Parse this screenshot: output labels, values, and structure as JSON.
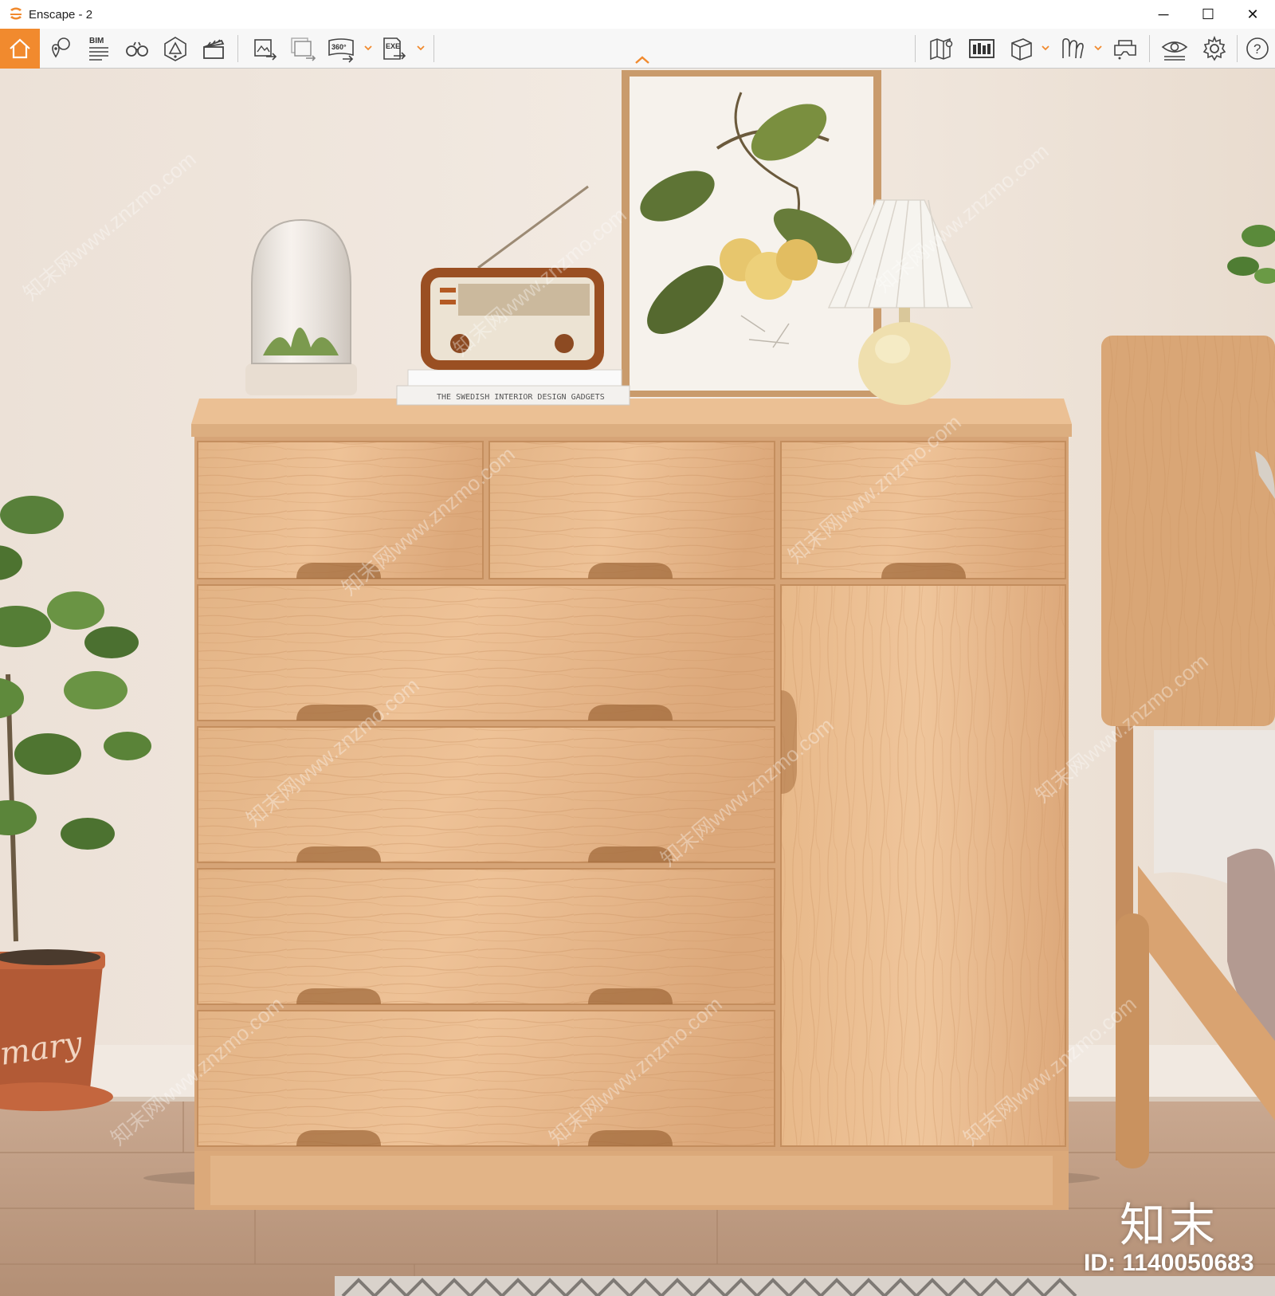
{
  "window": {
    "title": "Enscape - 2",
    "minimize_glyph": "─",
    "maximize_glyph": "☐",
    "close_glyph": "✕"
  },
  "toolbar": {
    "accent_color": "#f18a2e",
    "buttons": [
      {
        "name": "home-icon",
        "label": ""
      },
      {
        "name": "location-pin-icon",
        "label": ""
      },
      {
        "name": "bim-icon",
        "label": "BIM"
      },
      {
        "name": "binoculars-icon",
        "label": ""
      },
      {
        "name": "atmosphere-icon",
        "label": ""
      },
      {
        "name": "clapperboard-icon",
        "label": ""
      },
      {
        "name": "export-image-icon",
        "label": ""
      },
      {
        "name": "batch-render-icon",
        "label": ""
      },
      {
        "name": "panorama-export-icon",
        "label": "360°"
      },
      {
        "name": "exe-export-icon",
        "label": "EXE"
      },
      {
        "name": "map-icon",
        "label": ""
      },
      {
        "name": "asset-library-icon",
        "label": ""
      },
      {
        "name": "view-cube-icon",
        "label": ""
      },
      {
        "name": "materials-icon",
        "label": ""
      },
      {
        "name": "vr-headset-icon",
        "label": ""
      },
      {
        "name": "visual-settings-icon",
        "label": ""
      },
      {
        "name": "settings-icon",
        "label": ""
      },
      {
        "name": "help-icon",
        "label": "?"
      }
    ]
  },
  "viewport": {
    "watermark_text": "知末网www.znzmo.com",
    "book_spine_text": "THE SWEDISH INTERIOR DESIGN GADGETS",
    "pot_label": "mary",
    "brand_mark": "知末",
    "id_label": "ID: 1140050683"
  }
}
